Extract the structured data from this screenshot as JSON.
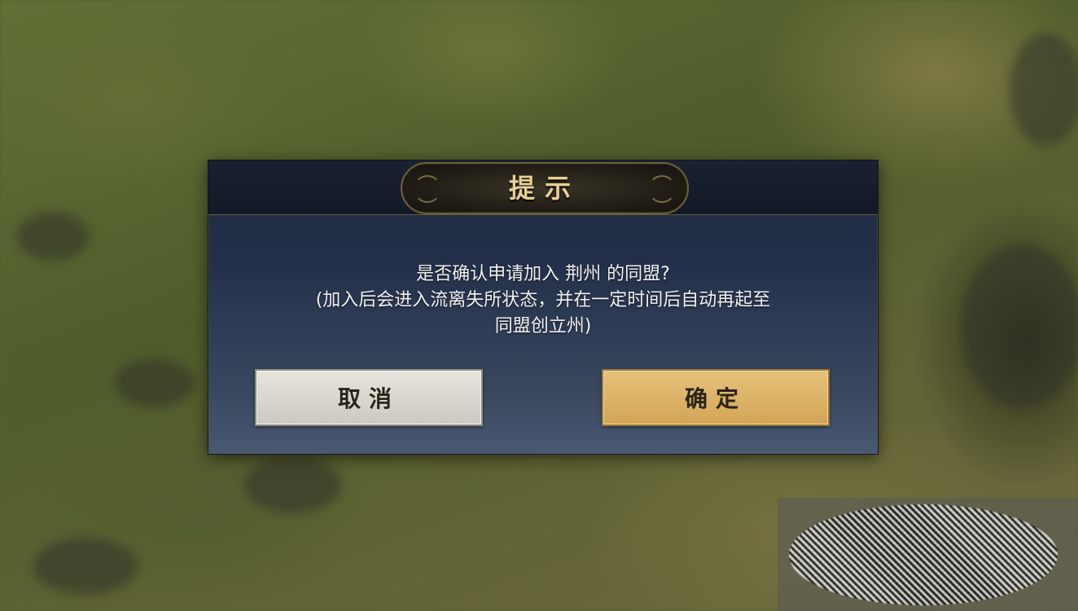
{
  "dialog": {
    "title": "提示",
    "message_lines": [
      "是否确认申请加入 荆州 的同盟?",
      "(加入后会进入流离失所状态，并在一定时间后自动再起至",
      "同盟创立州)"
    ],
    "cancel_label": "取消",
    "confirm_label": "确定"
  },
  "colors": {
    "title_gold": "#e8cf92",
    "confirm_button": "#d9b063",
    "cancel_button": "#dcd9d1",
    "panel_navy": "#24304a"
  }
}
